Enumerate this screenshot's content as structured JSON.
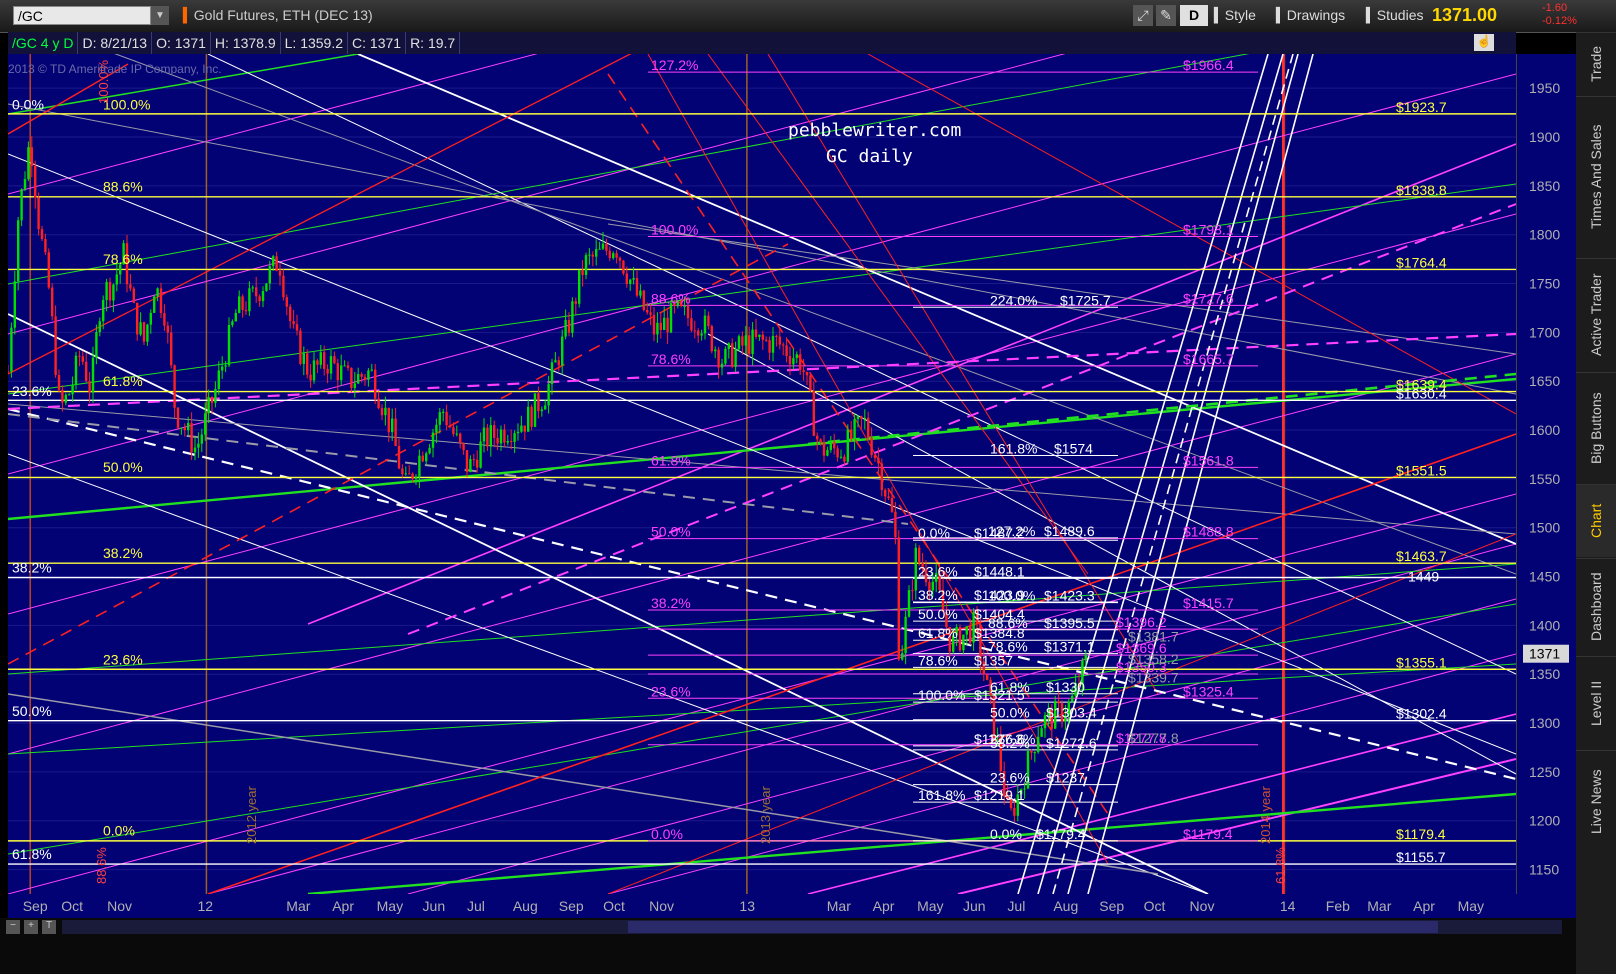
{
  "toolbar": {
    "symbol": "/GC",
    "instrument": "Gold Futures, ETH (DEC 13)",
    "aggregation_button": "D",
    "style_label": "Style",
    "drawings_label": "Drawings",
    "studies_label": "Studies",
    "last_price": "1371.00",
    "change": "-1.60",
    "change_pct": "-0.12%"
  },
  "info_bar": {
    "symbol": "/GC 4 y D",
    "date": "D: 8/21/13",
    "open": "O: 1371",
    "high": "H: 1378.9",
    "low": "L: 1359.2",
    "close": "C: 1371",
    "range": "R: 19.7"
  },
  "copyright": "2013 © TD Ameritrade IP Company, Inc.",
  "watermark": {
    "line1": "pebblewriter.com",
    "line2": "GC daily"
  },
  "sidebar_tabs": [
    "Trade",
    "Times And Sales",
    "Active Trader",
    "Big Buttons",
    "Chart",
    "Dashboard",
    "Level II",
    "Live News"
  ],
  "colors": {
    "plot_bg": "#020275",
    "candle_up": "#00e000",
    "candle_down": "#ff2020",
    "yellow": "#ffff40",
    "magenta": "#ff40ff",
    "white": "#ffffff",
    "green": "#20e020",
    "red": "#ff2020",
    "gray": "#9a9aa8"
  },
  "chart_data": {
    "type": "candlestick",
    "ylim": [
      1125,
      1985
    ],
    "xlabels": [
      "Sep",
      "Oct",
      "Nov",
      "12",
      "Mar",
      "Apr",
      "May",
      "Jun",
      "Jul",
      "Aug",
      "Sep",
      "Oct",
      "Nov",
      "13",
      "Mar",
      "Apr",
      "May",
      "Jun",
      "Jul",
      "Aug",
      "Sep",
      "Oct",
      "Nov",
      "14",
      "Feb",
      "Mar",
      "Apr",
      "May"
    ],
    "yticks": [
      1150,
      1200,
      1250,
      1300,
      1350,
      1400,
      1450,
      1500,
      1550,
      1600,
      1650,
      1700,
      1750,
      1800,
      1850,
      1900,
      1950
    ],
    "current_price_tag": "1371",
    "close_path": [
      [
        "2011-08-22",
        1660
      ],
      [
        "2011-08-29",
        1820
      ],
      [
        "2011-09-06",
        1900
      ],
      [
        "2011-09-12",
        1810
      ],
      [
        "2011-09-19",
        1740
      ],
      [
        "2011-09-26",
        1620
      ],
      [
        "2011-10-03",
        1640
      ],
      [
        "2011-10-10",
        1680
      ],
      [
        "2011-10-17",
        1640
      ],
      [
        "2011-10-24",
        1740
      ],
      [
        "2011-11-01",
        1750
      ],
      [
        "2011-11-08",
        1780
      ],
      [
        "2011-11-15",
        1720
      ],
      [
        "2011-11-22",
        1690
      ],
      [
        "2011-11-29",
        1750
      ],
      [
        "2011-12-06",
        1720
      ],
      [
        "2011-12-13",
        1620
      ],
      [
        "2011-12-27",
        1580
      ],
      [
        "2012-01-09",
        1640
      ],
      [
        "2012-01-23",
        1720
      ],
      [
        "2012-02-06",
        1740
      ],
      [
        "2012-02-21",
        1775
      ],
      [
        "2012-03-01",
        1700
      ],
      [
        "2012-03-12",
        1660
      ],
      [
        "2012-03-26",
        1670
      ],
      [
        "2012-04-09",
        1650
      ],
      [
        "2012-04-23",
        1660
      ],
      [
        "2012-05-07",
        1600
      ],
      [
        "2012-05-16",
        1540
      ],
      [
        "2012-05-28",
        1580
      ],
      [
        "2012-06-11",
        1620
      ],
      [
        "2012-06-28",
        1560
      ],
      [
        "2012-07-09",
        1590
      ],
      [
        "2012-07-23",
        1600
      ],
      [
        "2012-08-06",
        1610
      ],
      [
        "2012-08-20",
        1640
      ],
      [
        "2012-09-04",
        1710
      ],
      [
        "2012-09-14",
        1770
      ],
      [
        "2012-10-05",
        1790
      ],
      [
        "2012-10-19",
        1740
      ],
      [
        "2012-11-01",
        1700
      ],
      [
        "2012-11-15",
        1720
      ],
      [
        "2012-12-03",
        1710
      ],
      [
        "2012-12-17",
        1670
      ],
      [
        "2013-01-02",
        1690
      ],
      [
        "2013-01-22",
        1690
      ],
      [
        "2013-02-08",
        1670
      ],
      [
        "2013-02-20",
        1580
      ],
      [
        "2013-03-08",
        1580
      ],
      [
        "2013-03-22",
        1610
      ],
      [
        "2013-04-02",
        1560
      ],
      [
        "2013-04-12",
        1500
      ],
      [
        "2013-04-15",
        1360
      ],
      [
        "2013-04-26",
        1470
      ],
      [
        "2013-05-10",
        1440
      ],
      [
        "2013-05-20",
        1380
      ],
      [
        "2013-06-05",
        1400
      ],
      [
        "2013-06-20",
        1280
      ],
      [
        "2013-06-28",
        1200
      ],
      [
        "2013-07-05",
        1230
      ],
      [
        "2013-07-19",
        1300
      ],
      [
        "2013-08-01",
        1310
      ],
      [
        "2013-08-09",
        1320
      ],
      [
        "2013-08-21",
        1371
      ]
    ],
    "right_labels_yellow": [
      {
        "text": "$1923.7",
        "y": 1923.7
      },
      {
        "text": "$1838.8",
        "y": 1838.8
      },
      {
        "text": "$1764.4",
        "y": 1764.4
      },
      {
        "text": "$1639.4",
        "y": 1639.4
      },
      {
        "text": "$1551.5",
        "y": 1551.5
      },
      {
        "text": "$1463.7",
        "y": 1463.7
      },
      {
        "text": "$1355.1",
        "y": 1355.1
      },
      {
        "text": "$1179.4",
        "y": 1179.4
      }
    ],
    "right_labels_white": [
      {
        "text": "$1630.4",
        "y": 1630.4
      },
      {
        "text": "1449",
        "y": 1449
      },
      {
        "text": "$1302.4",
        "y": 1302.4
      },
      {
        "text": "$1155.7",
        "y": 1155.7
      }
    ],
    "left_fib_labels": [
      {
        "text": "0.0%",
        "y": 1926,
        "color": "white"
      },
      {
        "text": "100.0%",
        "y": 1926,
        "color": "yellow"
      },
      {
        "text": "88.6%",
        "y": 1842,
        "color": "yellow"
      },
      {
        "text": "78.6%",
        "y": 1768,
        "color": "yellow"
      },
      {
        "text": "23.6%",
        "y": 1633,
        "color": "white"
      },
      {
        "text": "61.8%",
        "y": 1643,
        "color": "yellow"
      },
      {
        "text": "50.0%",
        "y": 1555,
        "color": "yellow"
      },
      {
        "text": "38.2%",
        "y": 1467,
        "color": "yellow"
      },
      {
        "text": "38.2%",
        "y": 1452,
        "color": "white"
      },
      {
        "text": "23.6%",
        "y": 1358,
        "color": "yellow"
      },
      {
        "text": "50.0%",
        "y": 1305,
        "color": "white"
      },
      {
        "text": "0.0%",
        "y": 1183,
        "color": "yellow"
      },
      {
        "text": "61.8%",
        "y": 1159,
        "color": "white"
      }
    ],
    "magenta_fib_labels": [
      {
        "text": "127.2%",
        "y": 1966.4
      },
      {
        "text": "$1966.4",
        "y": 1966.4
      },
      {
        "text": "100.0%",
        "y": 1798.1
      },
      {
        "text": "$1798.1",
        "y": 1798.1
      },
      {
        "text": "88.6%",
        "y": 1727.6
      },
      {
        "text": "$1727.6",
        "y": 1727.6
      },
      {
        "text": "78.6%",
        "y": 1665.7
      },
      {
        "text": "$1665.7",
        "y": 1665.7
      },
      {
        "text": "61.8%",
        "y": 1561.8
      },
      {
        "text": "$1561.8",
        "y": 1561.8
      },
      {
        "text": "50.0%",
        "y": 1488.8
      },
      {
        "text": "$1488.8",
        "y": 1488.8
      },
      {
        "text": "38.2%",
        "y": 1415.7
      },
      {
        "text": "$1415.7",
        "y": 1415.7
      },
      {
        "text": "23.6%",
        "y": 1325.4
      },
      {
        "text": "$1325.4",
        "y": 1325.4
      },
      {
        "text": "0.0%",
        "y": 1179.4
      },
      {
        "text": "$1179.4",
        "y": 1179.4
      },
      {
        "text": "$1396.2",
        "y": 1396.2
      },
      {
        "text": "$1369.6",
        "y": 1369.6
      },
      {
        "text": "$1350.3",
        "y": 1350.3
      },
      {
        "text": "$1277.8",
        "y": 1277.8
      }
    ],
    "white_fib_labels": [
      {
        "text": "224.0%",
        "y": 1725.7
      },
      {
        "text": "$1725.7",
        "y": 1725.7
      },
      {
        "text": "161.8%",
        "y": 1574
      },
      {
        "text": "$1574",
        "y": 1574
      },
      {
        "text": "0.0%",
        "y": 1487.2
      },
      {
        "text": "$1487.2",
        "y": 1487.2
      },
      {
        "text": "127.2%",
        "y": 1489.6
      },
      {
        "text": "$1489.6",
        "y": 1489.6
      },
      {
        "text": "23.6%",
        "y": 1448.1
      },
      {
        "text": "$1448.1",
        "y": 1448.1
      },
      {
        "text": "38.2%",
        "y": 1423.9
      },
      {
        "text": "$1423.9",
        "y": 1423.9
      },
      {
        "text": "100.0%",
        "y": 1423.3
      },
      {
        "text": "$1423.3",
        "y": 1423.3
      },
      {
        "text": "50.0%",
        "y": 1404.4
      },
      {
        "text": "$1404.4",
        "y": 1404.4
      },
      {
        "text": "88.6%",
        "y": 1395.5
      },
      {
        "text": "$1395.5",
        "y": 1395.5
      },
      {
        "text": "61.8%",
        "y": 1384.8
      },
      {
        "text": "$1384.8",
        "y": 1384.8
      },
      {
        "text": "78.6%",
        "y": 1371.1
      },
      {
        "text": "$1371.1",
        "y": 1371.1
      },
      {
        "text": "78.6%",
        "y": 1357
      },
      {
        "text": "$1357",
        "y": 1357
      },
      {
        "text": "61.8%",
        "y": 1330
      },
      {
        "text": "$1330",
        "y": 1330
      },
      {
        "text": "100.0%",
        "y": 1321.5
      },
      {
        "text": "$1321.5",
        "y": 1321.5
      },
      {
        "text": "50.0%",
        "y": 1303.4
      },
      {
        "text": "$1303.4",
        "y": 1303.4
      },
      {
        "text": "127.2%",
        "y": 1276.6
      },
      {
        "text": "$1276.6",
        "y": 1276.6
      },
      {
        "text": "38.2%",
        "y": 1272.6
      },
      {
        "text": "$1272.6",
        "y": 1272.6
      },
      {
        "text": "23.6%",
        "y": 1237
      },
      {
        "text": "$1237",
        "y": 1237
      },
      {
        "text": "161.8%",
        "y": 1219.1
      },
      {
        "text": "$1219.1",
        "y": 1219.1
      },
      {
        "text": "0.0%",
        "y": 1179.4
      },
      {
        "text": "$1179.4",
        "y": 1179.4
      }
    ],
    "gray_labels": [
      {
        "text": "$1381.7",
        "y": 1381.7
      },
      {
        "text": "$1358.2",
        "y": 1358.2
      },
      {
        "text": "$1339.7",
        "y": 1339.7
      },
      {
        "text": "$1277.8",
        "y": 1277.8
      }
    ],
    "vertical_labels": [
      {
        "text": "2012 year",
        "color": "orange"
      },
      {
        "text": "2013 year",
        "color": "orange"
      },
      {
        "text": "2014 year",
        "color": "orange"
      },
      {
        "text": "88.6%",
        "color": "red"
      },
      {
        "text": "61.8%",
        "color": "red"
      },
      {
        "text": "100.0%",
        "color": "red"
      }
    ],
    "grid": true
  }
}
